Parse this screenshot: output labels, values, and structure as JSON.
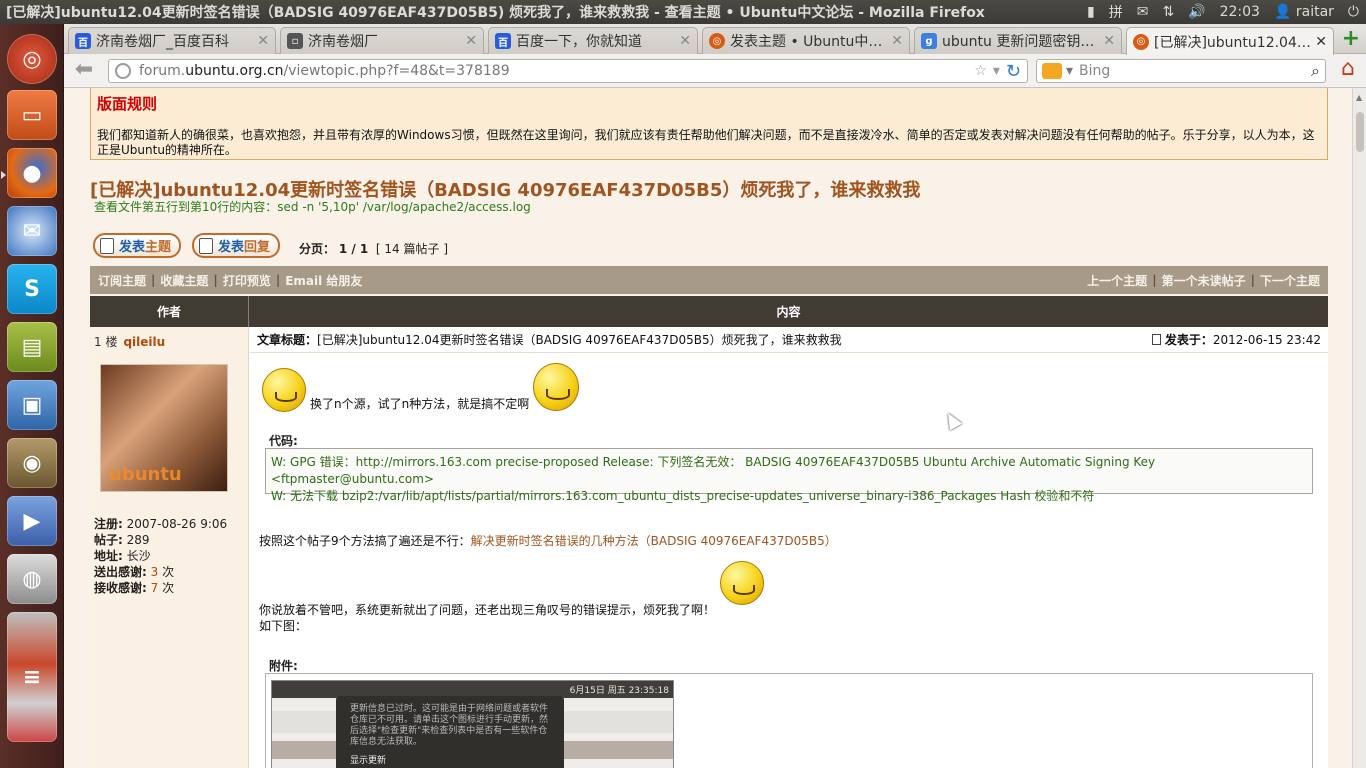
{
  "window": {
    "title": "[已解决]ubuntu12.04更新时签名错误（BADSIG 40976EAF437D05B5) 烦死我了，谁来救救我 - 查看主题 • Ubuntu中文论坛 - Mozilla Firefox"
  },
  "tray": {
    "input_method": "拼",
    "time": "22:03",
    "user": "raitar"
  },
  "launcher": {
    "items": [
      "dash",
      "files",
      "firefox",
      "thunderbird",
      "skype",
      "books",
      "image-viewer",
      "gimp",
      "video-editor",
      "speaker",
      "more"
    ]
  },
  "tabs": [
    {
      "label": "济南卷烟厂_百度百科",
      "color": "#2a5cd6"
    },
    {
      "label": "济南卷烟厂",
      "color": "#555555"
    },
    {
      "label": "百度一下，你就知道",
      "color": "#2a5cd6"
    },
    {
      "label": "发表主题 • Ubuntu中…",
      "color": "#d65c15"
    },
    {
      "label": "ubuntu 更新问题密钥…",
      "color": "#3c7fe0"
    },
    {
      "label": "[已解决]ubuntu12.04…",
      "color": "#d65c15"
    }
  ],
  "nav": {
    "url_prefix": "forum.",
    "url_domain": "ubuntu.org.cn",
    "url_path": "/viewtopic.php?f=48&t=378189",
    "search_placeholder": "Bing"
  },
  "rules": {
    "heading": "版面规则",
    "text": "我们都知道新人的确很菜，也喜欢抱怨，并且带有浓厚的Windows习惯，但既然在这里询问，我们就应该有责任帮助他们解决问题，而不是直接泼冷水、简单的否定或发表对解决问题没有任何帮助的帖子。乐于分享，以人为本，这正是Ubuntu的精神所在。"
  },
  "topic": {
    "title": "[已解决]ubuntu12.04更新时签名错误（BADSIG 40976EAF437D05B5）烦死我了，谁来救救我",
    "subline": "查看文件第五行到第10行的内容：sed -n '5,10p' /var/log/apache2/access.log"
  },
  "buttons": {
    "new_topic_a": "发表",
    "new_topic_b": "主题",
    "reply_a": "发表",
    "reply_b": "回复"
  },
  "pagination": {
    "label": "分页：",
    "pages": "1 / 1",
    "count": "[ 14 篇帖子 ]"
  },
  "options": {
    "left": [
      "订阅主题",
      "收藏主题",
      "打印预览",
      "Email 给朋友"
    ],
    "right": [
      "上一个主题",
      "第一个未读帖子",
      "下一个主题"
    ]
  },
  "table": {
    "author_col": "作者",
    "content_col": "内容"
  },
  "post": {
    "floor": "1 楼",
    "author": "qileilu",
    "avatar_watermark": "ubuntu",
    "profile": {
      "reg_label": "注册:",
      "reg_value": "2007-08-26 9:06",
      "posts_label": "帖子:",
      "posts_value": "289",
      "loc_label": "地址:",
      "loc_value": "长沙",
      "thanks_sent_label": "送出感谢:",
      "thanks_sent_value": "3",
      "thanks_sent_unit": "次",
      "thanks_recv_label": "接收感谢:",
      "thanks_recv_value": "7",
      "thanks_recv_unit": "次"
    },
    "subject_label": "文章标题：",
    "subject": "[已解决]ubuntu12.04更新时签名错误（BADSIG 40976EAF437D05B5）烦死我了，谁来救救我",
    "posted_label": "发表于：",
    "posted_value": "2012-06-15 23:42",
    "line1": "换了n个源，试了n种方法，就是搞不定啊",
    "code_label": "代码:",
    "code_line1": "W: GPG 错误：http://mirrors.163.com precise-proposed Release: 下列签名无效： BADSIG 40976EAF437D05B5 Ubuntu Archive Automatic Signing Key <ftpmaster@ubuntu.com>",
    "code_line2": "W: 无法下载 bzip2:/var/lib/apt/lists/partial/mirrors.163.com_ubuntu_dists_precise-updates_universe_binary-i386_Packages Hash 校验和不符",
    "line2_prefix": "按照这个帖子9个方法搞了遍还是不行：",
    "line2_link": "解决更新时签名错误的几种方法（BADSIG 40976EAF437D05B5）",
    "line3": "你说放着不管吧，系统更新就出了问题，还老出现三角叹号的错误提示，烦死我了啊！",
    "line4": "如下图：",
    "attach_label": "附件:",
    "attach_panel_time": "6月15日 周五 23:35:18",
    "attach_note": "更新信息已过时。这可能是由于网络问题或者软件仓库已不可用。请单击这个图标进行手动更新，然后选择\"检查更新\"来检查列表中是否有一些软件仓库信息无法获取。",
    "attach_note_action": "显示更新"
  }
}
